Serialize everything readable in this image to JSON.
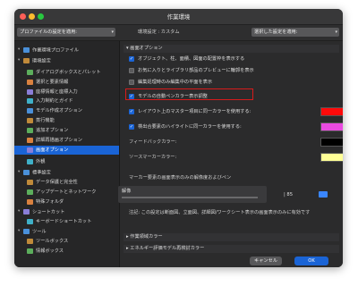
{
  "window": {
    "title": "作業環境"
  },
  "toolbar": {
    "apply_profile": "プロファイルの設定を適用:",
    "env_setting_label": "環境設定 : カスタム",
    "apply_selected": "選択した設定を適用:"
  },
  "sidebar": {
    "items": [
      {
        "label": "作業環境プロファイル",
        "level": 0
      },
      {
        "label": "環境設定",
        "level": 0
      },
      {
        "label": "ダイアログボックスとパレット",
        "level": 1
      },
      {
        "label": "選択と要素情報",
        "level": 1
      },
      {
        "label": "座標情報と座標入力",
        "level": 1
      },
      {
        "label": "入力制約とガイド",
        "level": 1
      },
      {
        "label": "モデル作成オプション",
        "level": 1
      },
      {
        "label": "蒸行機能",
        "level": 1
      },
      {
        "label": "追加オプション",
        "level": 1
      },
      {
        "label": "詳細再描画オプション",
        "level": 1
      },
      {
        "label": "画面オプション",
        "level": 1
      },
      {
        "label": "外観",
        "level": 1
      },
      {
        "label": "標準設定",
        "level": 0
      },
      {
        "label": "データ保護と完全性",
        "level": 1
      },
      {
        "label": "アップデートとネットワーク",
        "level": 1
      },
      {
        "label": "特殊フォルダ",
        "level": 1
      },
      {
        "label": "ショートカット",
        "level": 0
      },
      {
        "label": "キーボードショートカット",
        "level": 1
      },
      {
        "label": "ツール",
        "level": 0
      },
      {
        "label": "ツールボックス",
        "level": 1
      },
      {
        "label": "情報ボックス",
        "level": 1
      }
    ],
    "selected_index": 10
  },
  "main": {
    "section_display": "画面オプション",
    "options": [
      {
        "label": "オブジェクト、柱、面積、図面の配置枠を表示する",
        "checked": true
      },
      {
        "label": "お気に入りとライブラリ部品のプレビューに輪郭を表示",
        "checked": false
      },
      {
        "label": "編集処理時のみ編集中の平面を表示",
        "checked": false
      },
      {
        "label": "モデルの自動ペンカラー表示調整",
        "checked": true
      }
    ],
    "marquee_label": "レイアウト上のマスター項目に同一カラーを使用する:",
    "marquee_color": "#ff0a0a",
    "highlight_label": "検出合要素のハイライトに同一カラーを使用する:",
    "highlight_color": "#e94ae0",
    "feedback_label": "フィードバックカラー:",
    "feedback_color": "#000000",
    "source_marker_label": "ソースマーカーカラー:",
    "source_marker_color": "#ffff96",
    "marker_section": "マーカー要素の画面表示のみの解像度およびペン",
    "slider_label": "解像",
    "pen_number": "85",
    "note": "注記: この設定は断面図、立面図、詳細図/ワークシート表示の画面表示のみに有効です",
    "collapsed_sections": [
      "作業領域カラー",
      "エネルギー評価モデル再検討カラー"
    ]
  },
  "buttons": {
    "cancel": "キャンセル",
    "ok": "OK"
  }
}
